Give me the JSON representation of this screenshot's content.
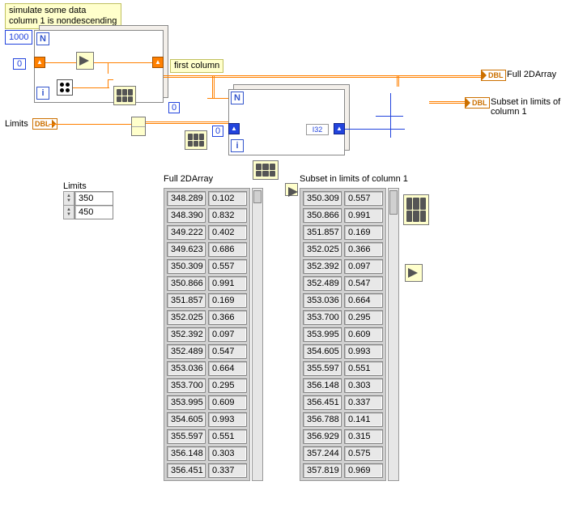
{
  "comment": {
    "line1": "simulate some data",
    "line2": "column 1 is nondescending"
  },
  "constants": {
    "n1": "1000",
    "zero1": "0",
    "zero2": "0",
    "zero3": "0",
    "first_column": "first column",
    "i32": "I32"
  },
  "terminals": {
    "limits_in": "DBL",
    "full_out": "DBL",
    "subset_out": "DBL",
    "full_label": "Full 2DArray",
    "subset_label": "Subset in limits of column 1",
    "limits_label": "Limits"
  },
  "loops": {
    "n": "N",
    "i": "i"
  },
  "limits_control": {
    "label": "Limits",
    "values": [
      "350",
      "450"
    ]
  },
  "full_array": {
    "label": "Full 2DArray",
    "rows": [
      [
        "348.289",
        "0.102"
      ],
      [
        "348.390",
        "0.832"
      ],
      [
        "349.222",
        "0.402"
      ],
      [
        "349.623",
        "0.686"
      ],
      [
        "350.309",
        "0.557"
      ],
      [
        "350.866",
        "0.991"
      ],
      [
        "351.857",
        "0.169"
      ],
      [
        "352.025",
        "0.366"
      ],
      [
        "352.392",
        "0.097"
      ],
      [
        "352.489",
        "0.547"
      ],
      [
        "353.036",
        "0.664"
      ],
      [
        "353.700",
        "0.295"
      ],
      [
        "353.995",
        "0.609"
      ],
      [
        "354.605",
        "0.993"
      ],
      [
        "355.597",
        "0.551"
      ],
      [
        "356.148",
        "0.303"
      ],
      [
        "356.451",
        "0.337"
      ]
    ]
  },
  "subset_array": {
    "label": "Subset in limits of column 1",
    "rows": [
      [
        "350.309",
        "0.557"
      ],
      [
        "350.866",
        "0.991"
      ],
      [
        "351.857",
        "0.169"
      ],
      [
        "352.025",
        "0.366"
      ],
      [
        "352.392",
        "0.097"
      ],
      [
        "352.489",
        "0.547"
      ],
      [
        "353.036",
        "0.664"
      ],
      [
        "353.700",
        "0.295"
      ],
      [
        "353.995",
        "0.609"
      ],
      [
        "354.605",
        "0.993"
      ],
      [
        "355.597",
        "0.551"
      ],
      [
        "356.148",
        "0.303"
      ],
      [
        "356.451",
        "0.337"
      ],
      [
        "356.788",
        "0.141"
      ],
      [
        "356.929",
        "0.315"
      ],
      [
        "357.244",
        "0.575"
      ],
      [
        "357.819",
        "0.969"
      ]
    ]
  }
}
